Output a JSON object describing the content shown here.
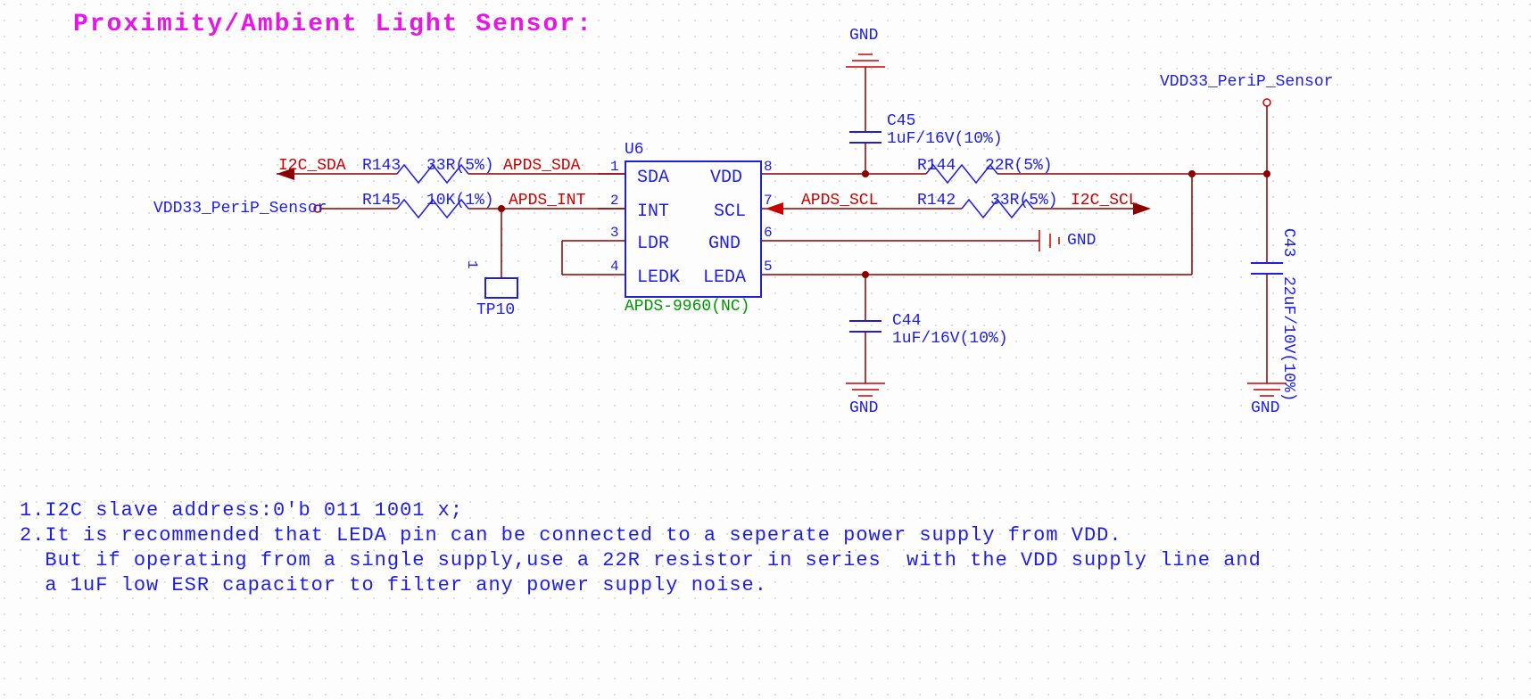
{
  "title": "Proximity/Ambient Light Sensor:",
  "chip": {
    "ref": "U6",
    "part": "APDS-9960(NC)",
    "pins": {
      "1": "SDA",
      "2": "INT",
      "3": "LDR",
      "4": "LEDK",
      "5": "LEDA",
      "6": "GND",
      "7": "SCL",
      "8": "VDD"
    }
  },
  "resistors": {
    "R143": {
      "ref": "R143",
      "val": "33R(5%)"
    },
    "R145": {
      "ref": "R145",
      "val": "10K(1%)"
    },
    "R144": {
      "ref": "R144",
      "val": "22R(5%)"
    },
    "R142": {
      "ref": "R142",
      "val": "33R(5%)"
    }
  },
  "caps": {
    "C45": {
      "ref": "C45",
      "val": "1uF/16V(10%)"
    },
    "C44": {
      "ref": "C44",
      "val": "1uF/16V(10%)"
    },
    "C43": {
      "ref": "C43",
      "val": "22uF/10V(10%)"
    }
  },
  "testpoint": {
    "ref": "TP10",
    "pin": "1"
  },
  "nets": {
    "i2c_sda": "I2C_SDA",
    "apds_sda": "APDS_SDA",
    "apds_int": "APDS_INT",
    "apds_scl": "APDS_SCL",
    "i2c_scl": "I2C_SCL",
    "vdd33_left": "VDD33_PeriP_Sensor",
    "vdd33_top": "VDD33_PeriP_Sensor"
  },
  "power": {
    "gnd": "GND"
  },
  "notes": {
    "line1": "1.I2C slave address:0'b 011 1001 x;",
    "line2": "2.It is recommended that LEDA pin can be connected to a seperate power supply from VDD.",
    "line3": "  But if operating from a single supply,use a 22R resistor in series  with the VDD supply line and",
    "line4": "  a 1uF low ESR capacitor to filter any power supply noise."
  }
}
